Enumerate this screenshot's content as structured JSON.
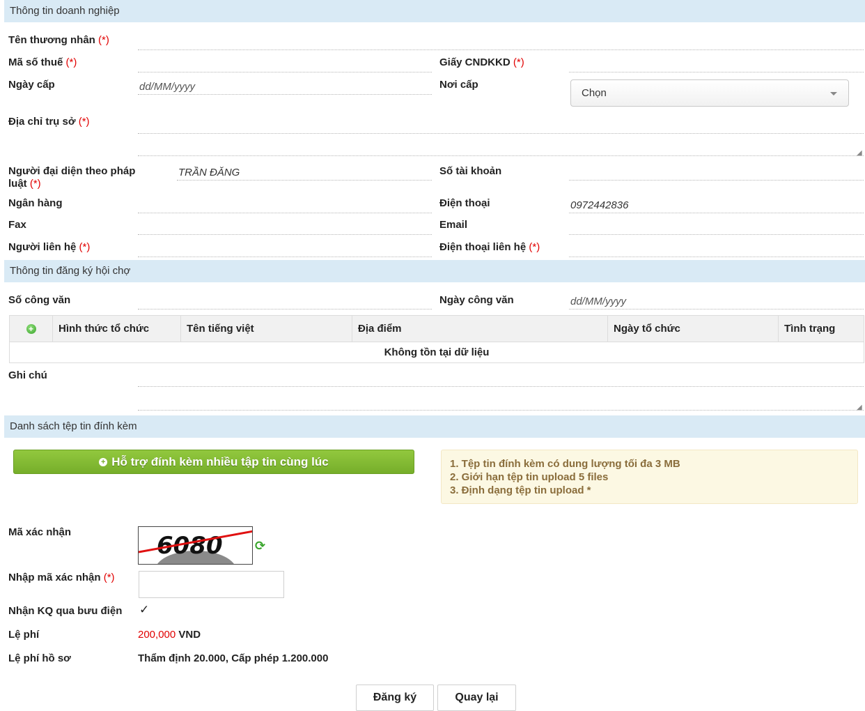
{
  "sections": {
    "business": "Thông tin doanh nghiệp",
    "fair": "Thông tin đăng ký hội chợ",
    "attachments": "Danh sách tệp tin đính kèm"
  },
  "required_mark": "(*)",
  "business": {
    "merchant_name_label": "Tên thương nhân",
    "tax_code_label": "Mã số thuế",
    "license_label": "Giấy CNDKKD",
    "issue_date_label": "Ngày cấp",
    "issue_date_placeholder": "dd/MM/yyyy",
    "issue_place_label": "Nơi cấp",
    "issue_place_value": "Chọn",
    "address_label": "Địa chỉ trụ sở",
    "legal_rep_label": "Người đại diện theo pháp luật",
    "legal_rep_value": "TRẦN ĐĂNG",
    "account_label": "Số tài khoản",
    "bank_label": "Ngân hàng",
    "phone_label": "Điện thoại",
    "phone_value": "0972442836",
    "fax_label": "Fax",
    "email_label": "Email",
    "contact_label": "Người liên hệ",
    "contact_phone_label": "Điện thoại liên hệ"
  },
  "fair": {
    "doc_no_label": "Số công văn",
    "doc_date_label": "Ngày công văn",
    "doc_date_placeholder": "dd/MM/yyyy",
    "table": {
      "add_icon": "plus-circle-icon",
      "columns": [
        "Hình thức tổ chức",
        "Tên tiếng việt",
        "Địa điểm",
        "Ngày tổ chức",
        "Tình trạng"
      ],
      "empty_message": "Không tồn tại dữ liệu"
    },
    "note_label": "Ghi chú"
  },
  "attachments": {
    "upload_button": "Hỗ trợ đính kèm nhiều tập tin cùng lúc",
    "notes": [
      "1. Tệp tin đính kèm có dung lượng tối đa 3 MB",
      "2. Giới hạn tệp tin upload 5 files",
      "3. Định dạng tệp tin upload *"
    ]
  },
  "captcha": {
    "label": "Mã xác nhận",
    "text": "6080",
    "input_label": "Nhập mã xác nhận",
    "refresh_icon": "refresh-icon"
  },
  "postal": {
    "label": "Nhận KQ qua bưu điện",
    "checked": true
  },
  "fee": {
    "label": "Lệ phí",
    "amount": "200,000",
    "currency": "VND",
    "dossier_label": "Lệ phí hồ sơ",
    "dossier_value": "Thẩm định 20.000, Cấp phép 1.200.000"
  },
  "buttons": {
    "register": "Đăng ký",
    "back": "Quay lại"
  },
  "colors": {
    "section_bg": "#d9eaf5",
    "required": "#e10000",
    "upload_green": "#80b933",
    "notice_bg": "#fcf8e3"
  }
}
